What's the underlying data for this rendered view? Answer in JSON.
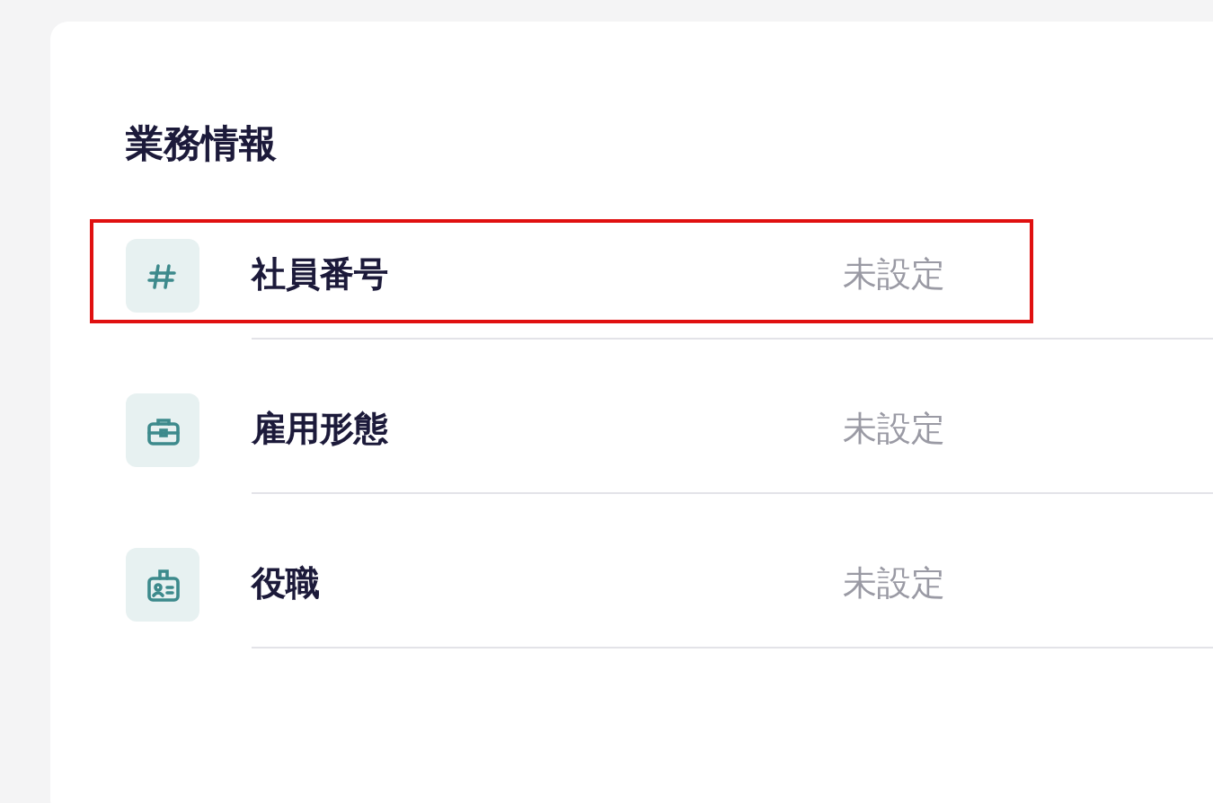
{
  "section": {
    "title": "業務情報"
  },
  "rows": [
    {
      "kind": "number",
      "label": "社員番号",
      "value": "未設定",
      "highlighted": true
    },
    {
      "kind": "briefcase",
      "label": "雇用形態",
      "value": "未設定",
      "highlighted": false
    },
    {
      "kind": "badge",
      "label": "役職",
      "value": "未設定",
      "highlighted": false
    }
  ]
}
